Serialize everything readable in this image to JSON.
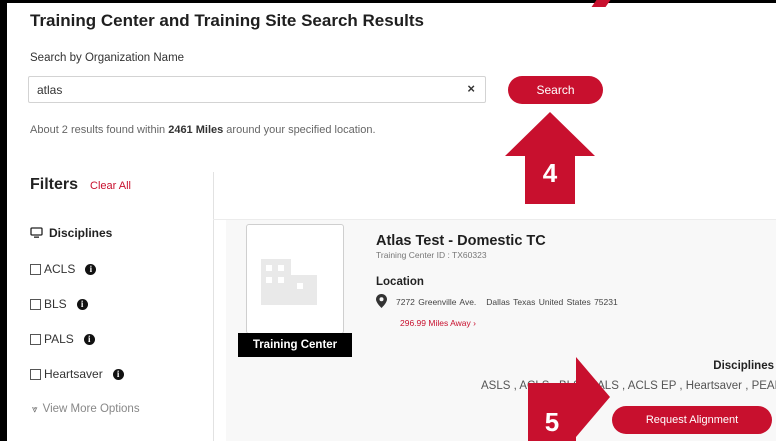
{
  "page": {
    "title": "Training Center and Training Site Search Results"
  },
  "search": {
    "label": "Search by Organization Name",
    "value": "atlas",
    "clear_glyph": "×",
    "button_label": "Search"
  },
  "results": {
    "prefix": "About 2 results found within ",
    "distance": "2461 Miles",
    "suffix": " around your specified location."
  },
  "annotations": {
    "step4": "4",
    "step5": "5",
    "color": "#c8102e"
  },
  "filters": {
    "title": "Filters",
    "clear_all": "Clear All",
    "disciplines_heading": "Disciplines",
    "options": [
      "ACLS",
      "BLS",
      "PALS",
      "Heartsaver"
    ],
    "info_glyph": "i",
    "view_more": "View More Options"
  },
  "result_card": {
    "type_label": "Training Center",
    "name": "Atlas Test - Domestic TC",
    "center_id": "Training Center ID : TX60323",
    "location_label": "Location",
    "street": "7272 Greenville Ave.",
    "city_line": "Dallas Texas United States 75231",
    "distance_link": "296.99 Miles Away ›",
    "disciplines_label": "Disciplines",
    "disciplines": "ASLS , ACLS , BLS , PALS , ACLS EP , Heartsaver , PEARS",
    "request_button": "Request Alignment"
  },
  "colors": {
    "accent": "#c8102e",
    "text": "#333333",
    "muted": "#777777"
  }
}
